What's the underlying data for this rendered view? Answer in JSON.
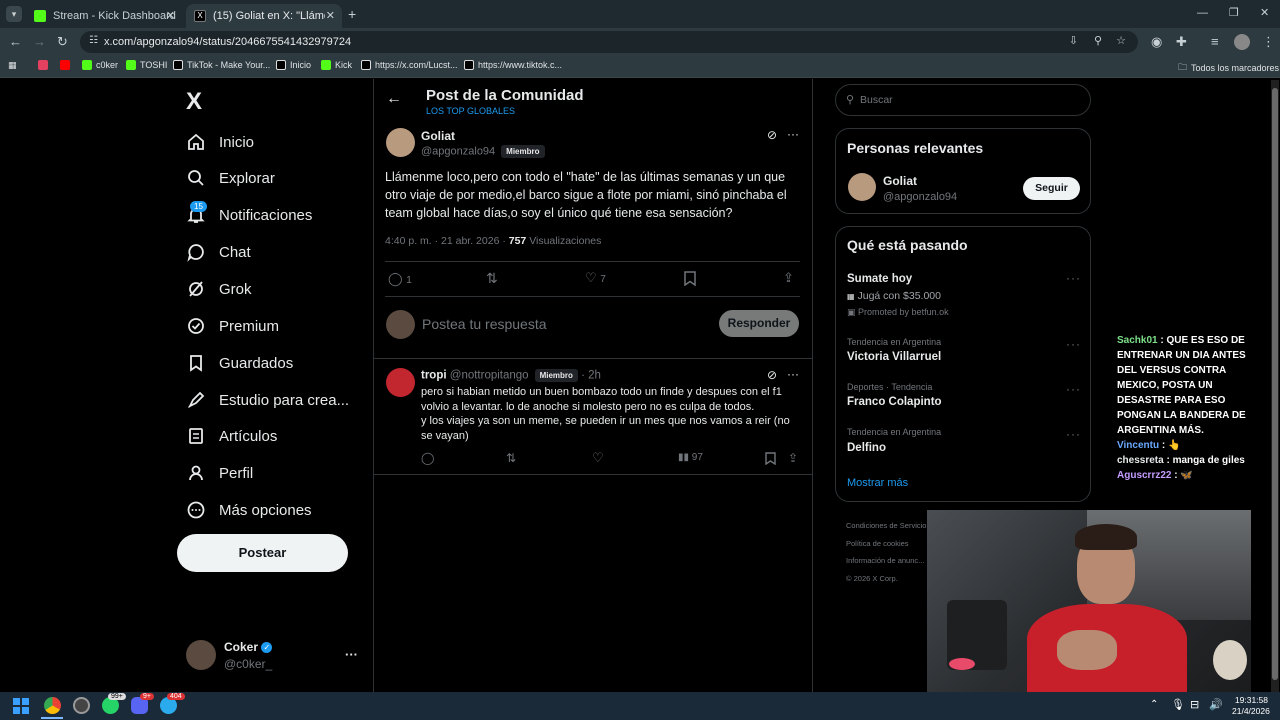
{
  "browser": {
    "tabs": [
      {
        "title": "Stream - Kick Dashboard",
        "favicon_color": "#53fc18"
      },
      {
        "title": "(15) Goliat en X: \"Llámenme loc",
        "favicon_color": "#000000"
      }
    ],
    "new_tab": "+",
    "url": "x.com/apgonzalo94/status/2046675541432979724",
    "bookmarks": [
      {
        "label": "",
        "color": "#e4405f"
      },
      {
        "label": "",
        "color": "#ff0000"
      },
      {
        "label": "c0ker",
        "color": "#53fc18"
      },
      {
        "label": "TOSHI",
        "color": "#53fc18"
      },
      {
        "label": "TikTok - Make Your...",
        "color": "#ffffff"
      },
      {
        "label": "Inicio",
        "color": "#ffffff"
      },
      {
        "label": "Kick",
        "color": "#53fc18"
      },
      {
        "label": "https://x.com/Lucst...",
        "color": "#ffffff"
      },
      {
        "label": "https://www.tiktok.c...",
        "color": "#ffffff"
      }
    ],
    "all_bookmarks": "Todos los marcadores"
  },
  "sidebar": {
    "logo": "X",
    "notif_count": "15",
    "items": [
      {
        "label": "Inicio",
        "icon": "home-icon"
      },
      {
        "label": "Explorar",
        "icon": "search-icon"
      },
      {
        "label": "Notificaciones",
        "icon": "bell-icon"
      },
      {
        "label": "Chat",
        "icon": "chat-icon"
      },
      {
        "label": "Grok",
        "icon": "grok-icon"
      },
      {
        "label": "Premium",
        "icon": "premium-icon"
      },
      {
        "label": "Guardados",
        "icon": "bookmark-icon"
      },
      {
        "label": "Estudio para crea...",
        "icon": "rocket-icon"
      },
      {
        "label": "Artículos",
        "icon": "article-icon"
      },
      {
        "label": "Perfil",
        "icon": "profile-icon"
      },
      {
        "label": "Más opciones",
        "icon": "more-icon"
      }
    ],
    "post_button": "Postear",
    "account": {
      "name": "Coker",
      "handle": "@c0ker_"
    }
  },
  "main": {
    "header_title": "Post de la Comunidad",
    "header_subtitle": "LOS TOP GLOBALES",
    "post": {
      "author": "Goliat",
      "handle": "@apgonzalo94",
      "member_badge": "Miembro",
      "text": "Llámenme loco,pero con todo el \"hate\" de las últimas semanas y un que otro viaje de por medio,el barco sigue a flote por miami, sinó pinchaba el team global hace días,o soy el único qué tiene esa sensación?",
      "time": "4:40 p. m. · 21 abr. 2026 · ",
      "views": "757",
      "views_label": " Visualizaciones",
      "replies": "1",
      "likes": "7"
    },
    "reply_box": {
      "placeholder": "Postea tu respuesta",
      "button": "Responder"
    },
    "reply": {
      "author": "tropi",
      "handle": "@nottropitango",
      "member_badge": "Miembro",
      "time": "· 2h",
      "text_1": "pero si habian metido un buen bombazo todo un finde y despues con el f1 volvio a levantar. lo de anoche si molesto pero no es culpa de todos.",
      "text_2": "y los viajes ya son un meme, se pueden ir un mes que nos vamos a reir (no se vayan)",
      "views": "97"
    }
  },
  "right": {
    "search_placeholder": "Buscar",
    "relevant_title": "Personas relevantes",
    "relevant_user": {
      "name": "Goliat",
      "handle": "@apgonzalo94",
      "follow": "Seguir"
    },
    "trending_title": "Qué está pasando",
    "trends": [
      {
        "context": "",
        "title": "Sumate hoy",
        "sub": "Jugá con $35.000",
        "promo": "Promoted by betfun.ok"
      },
      {
        "context": "Tendencia en Argentina",
        "title": "Victoria Villarruel"
      },
      {
        "context": "Deportes · Tendencia",
        "title": "Franco Colapinto"
      },
      {
        "context": "Tendencia en Argentina",
        "title": "Delfino"
      }
    ],
    "show_more": "Mostrar más",
    "footer": [
      "Condiciones de Servicio",
      "Política de cookies",
      "Información de anunc...",
      "© 2026 X Corp."
    ]
  },
  "stream_chat": [
    {
      "user": "Sachk01",
      "user_color": "#7ee08a",
      "msg": "QUE ES ESO DE ENTRENAR UN DIA ANTES DEL VERSUS CONTRA MEXICO, POSTA UN DESASTRE PARA ESO PONGAN LA BANDERA DE ARGENTINA MÁS."
    },
    {
      "user": "Vincentu",
      "user_color": "#6aa8ff",
      "msg": "👆"
    },
    {
      "user": "chessreta",
      "user_color": "#e7e9ea",
      "msg": "manga de giles"
    },
    {
      "user": "Aguscrrz22",
      "user_color": "#c59cff",
      "msg": "🦋"
    }
  ],
  "taskbar": {
    "time": "19:31:58",
    "date": "21/4/2026",
    "badges": [
      "99+",
      "9+",
      "404"
    ]
  }
}
